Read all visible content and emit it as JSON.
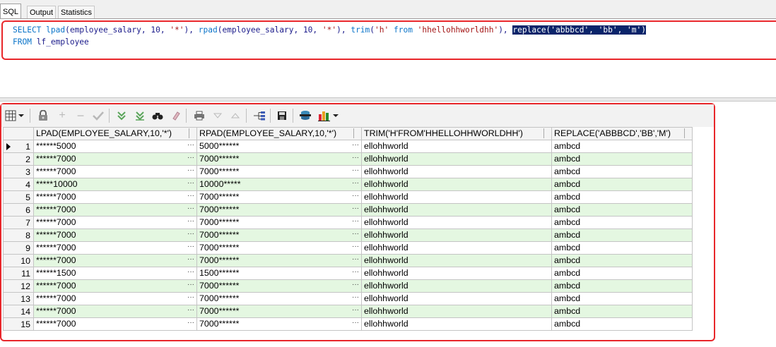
{
  "tabs": [
    {
      "label": "SQL",
      "active": true
    },
    {
      "label": "Output",
      "active": false
    },
    {
      "label": "Statistics",
      "active": false
    }
  ],
  "editor": {
    "line1": {
      "select": "SELECT",
      "lpad_fn": "lpad",
      "lpad_args_a": "(employee_salary, 10, ",
      "lpad_str": "'*'",
      "lpad_close": "), ",
      "rpad_fn": "rpad",
      "rpad_args_a": "(employee_salary, 10, ",
      "rpad_str": "'*'",
      "rpad_close": "), ",
      "trim_fn": "trim",
      "trim_open": "(",
      "trim_str1": "'h'",
      "trim_from": " from ",
      "trim_str2": "'hhellohhworldhh'",
      "trim_close": "), ",
      "replace_selected": "replace('abbbcd', 'bb', 'm')"
    },
    "line2": {
      "from": "FROM",
      "table": " lf_employee"
    }
  },
  "grid": {
    "columns": [
      "LPAD(EMPLOYEE_SALARY,10,'*')",
      "RPAD(EMPLOYEE_SALARY,10,'*')",
      "TRIM('H'FROM'HHELLOHHWORLDHH')",
      "REPLACE('ABBBCD','BB','M')"
    ],
    "rows": [
      {
        "n": "1",
        "lpad": "******5000",
        "rpad": "5000******",
        "trim": "ellohhworld",
        "replace": "ambcd"
      },
      {
        "n": "2",
        "lpad": "******7000",
        "rpad": "7000******",
        "trim": "ellohhworld",
        "replace": "ambcd"
      },
      {
        "n": "3",
        "lpad": "******7000",
        "rpad": "7000******",
        "trim": "ellohhworld",
        "replace": "ambcd"
      },
      {
        "n": "4",
        "lpad": "*****10000",
        "rpad": "10000*****",
        "trim": "ellohhworld",
        "replace": "ambcd"
      },
      {
        "n": "5",
        "lpad": "******7000",
        "rpad": "7000******",
        "trim": "ellohhworld",
        "replace": "ambcd"
      },
      {
        "n": "6",
        "lpad": "******7000",
        "rpad": "7000******",
        "trim": "ellohhworld",
        "replace": "ambcd"
      },
      {
        "n": "7",
        "lpad": "******7000",
        "rpad": "7000******",
        "trim": "ellohhworld",
        "replace": "ambcd"
      },
      {
        "n": "8",
        "lpad": "******7000",
        "rpad": "7000******",
        "trim": "ellohhworld",
        "replace": "ambcd"
      },
      {
        "n": "9",
        "lpad": "******7000",
        "rpad": "7000******",
        "trim": "ellohhworld",
        "replace": "ambcd"
      },
      {
        "n": "10",
        "lpad": "******7000",
        "rpad": "7000******",
        "trim": "ellohhworld",
        "replace": "ambcd"
      },
      {
        "n": "11",
        "lpad": "******1500",
        "rpad": "1500******",
        "trim": "ellohhworld",
        "replace": "ambcd"
      },
      {
        "n": "12",
        "lpad": "******7000",
        "rpad": "7000******",
        "trim": "ellohhworld",
        "replace": "ambcd"
      },
      {
        "n": "13",
        "lpad": "******7000",
        "rpad": "7000******",
        "trim": "ellohhworld",
        "replace": "ambcd"
      },
      {
        "n": "14",
        "lpad": "******7000",
        "rpad": "7000******",
        "trim": "ellohhworld",
        "replace": "ambcd"
      },
      {
        "n": "15",
        "lpad": "******7000",
        "rpad": "7000******",
        "trim": "ellohhworld",
        "replace": "ambcd"
      }
    ],
    "cell_button": "···"
  },
  "toolbar_icons": [
    "grid-view-icon",
    "lock-icon",
    "add-record-icon",
    "delete-record-icon",
    "post-edit-icon",
    "filter-icon",
    "filter-clear-icon",
    "find-icon",
    "eraser-icon",
    "print-icon",
    "sort-desc-icon",
    "sort-asc-icon",
    "tree-export-icon",
    "save-icon",
    "database-icon",
    "chart-icon"
  ],
  "colors": {
    "highlight_border": "#e8262a",
    "even_row": "#e4f7e1",
    "selection": "#0a246a"
  }
}
